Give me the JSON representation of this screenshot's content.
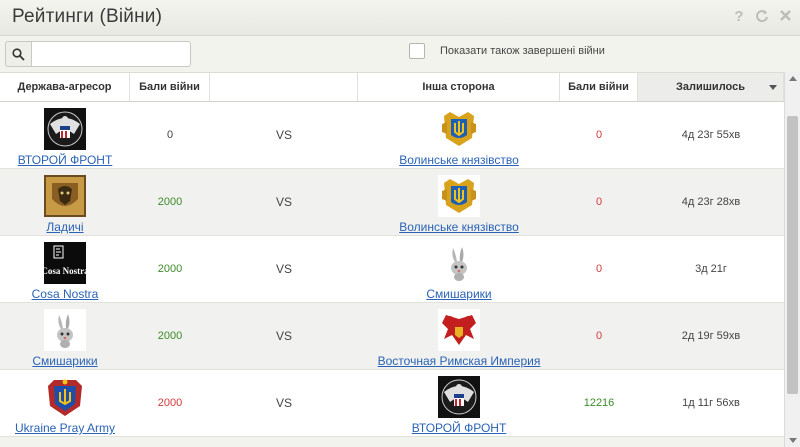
{
  "window": {
    "title": "Рейтинги (Війни)"
  },
  "toolbar": {
    "search_value": "",
    "show_finished_label": "Показати також завершені війни",
    "show_finished_checked": false
  },
  "columns": [
    "Держава-агресор",
    "Бали війни",
    "",
    "Інша сторона",
    "Бали війни",
    "Залишилось"
  ],
  "sorted_column": "Залишилось",
  "colors": {
    "link": "#2a63b5",
    "points_green": "#3d8b2a",
    "points_red": "#d03b3b"
  },
  "rows": [
    {
      "aggressor": "ВТОРОЙ ФРОНТ",
      "aggressor_emblem": "eagle-seal-icon",
      "aggressor_points": "0",
      "vs": "VS",
      "other": "Волинське князівство",
      "other_emblem": "trident-coat-of-arms-icon",
      "other_points": "0",
      "remaining": "4д 23г 55хв"
    },
    {
      "aggressor": "Ладичі",
      "aggressor_emblem": "lion-shield-icon",
      "aggressor_points": "2000",
      "vs": "VS",
      "other": "Волинське князівство",
      "other_emblem": "trident-coat-of-arms-icon",
      "other_points": "0",
      "remaining": "4д 23г 28хв"
    },
    {
      "aggressor": "Cosa Nostra",
      "aggressor_emblem": "cosa-nostra-logo-icon",
      "aggressor_points": "2000",
      "vs": "VS",
      "other": "Смишарики",
      "other_emblem": "rabbit-icon",
      "other_points": "0",
      "remaining": "3д 21г"
    },
    {
      "aggressor": "Смишарики",
      "aggressor_emblem": "rabbit-icon",
      "aggressor_points": "2000",
      "vs": "VS",
      "other": "Восточная Римская Империя",
      "other_emblem": "double-headed-eagle-icon",
      "other_points": "0",
      "remaining": "2д 19г 59хв"
    },
    {
      "aggressor": "Ukraine Pray Army",
      "aggressor_emblem": "blue-coat-of-arms-icon",
      "aggressor_points": "2000",
      "vs": "VS",
      "other": "ВТОРОЙ ФРОНТ",
      "other_emblem": "eagle-seal-icon",
      "other_points": "12216",
      "remaining": "1д 11г 56хв"
    }
  ]
}
